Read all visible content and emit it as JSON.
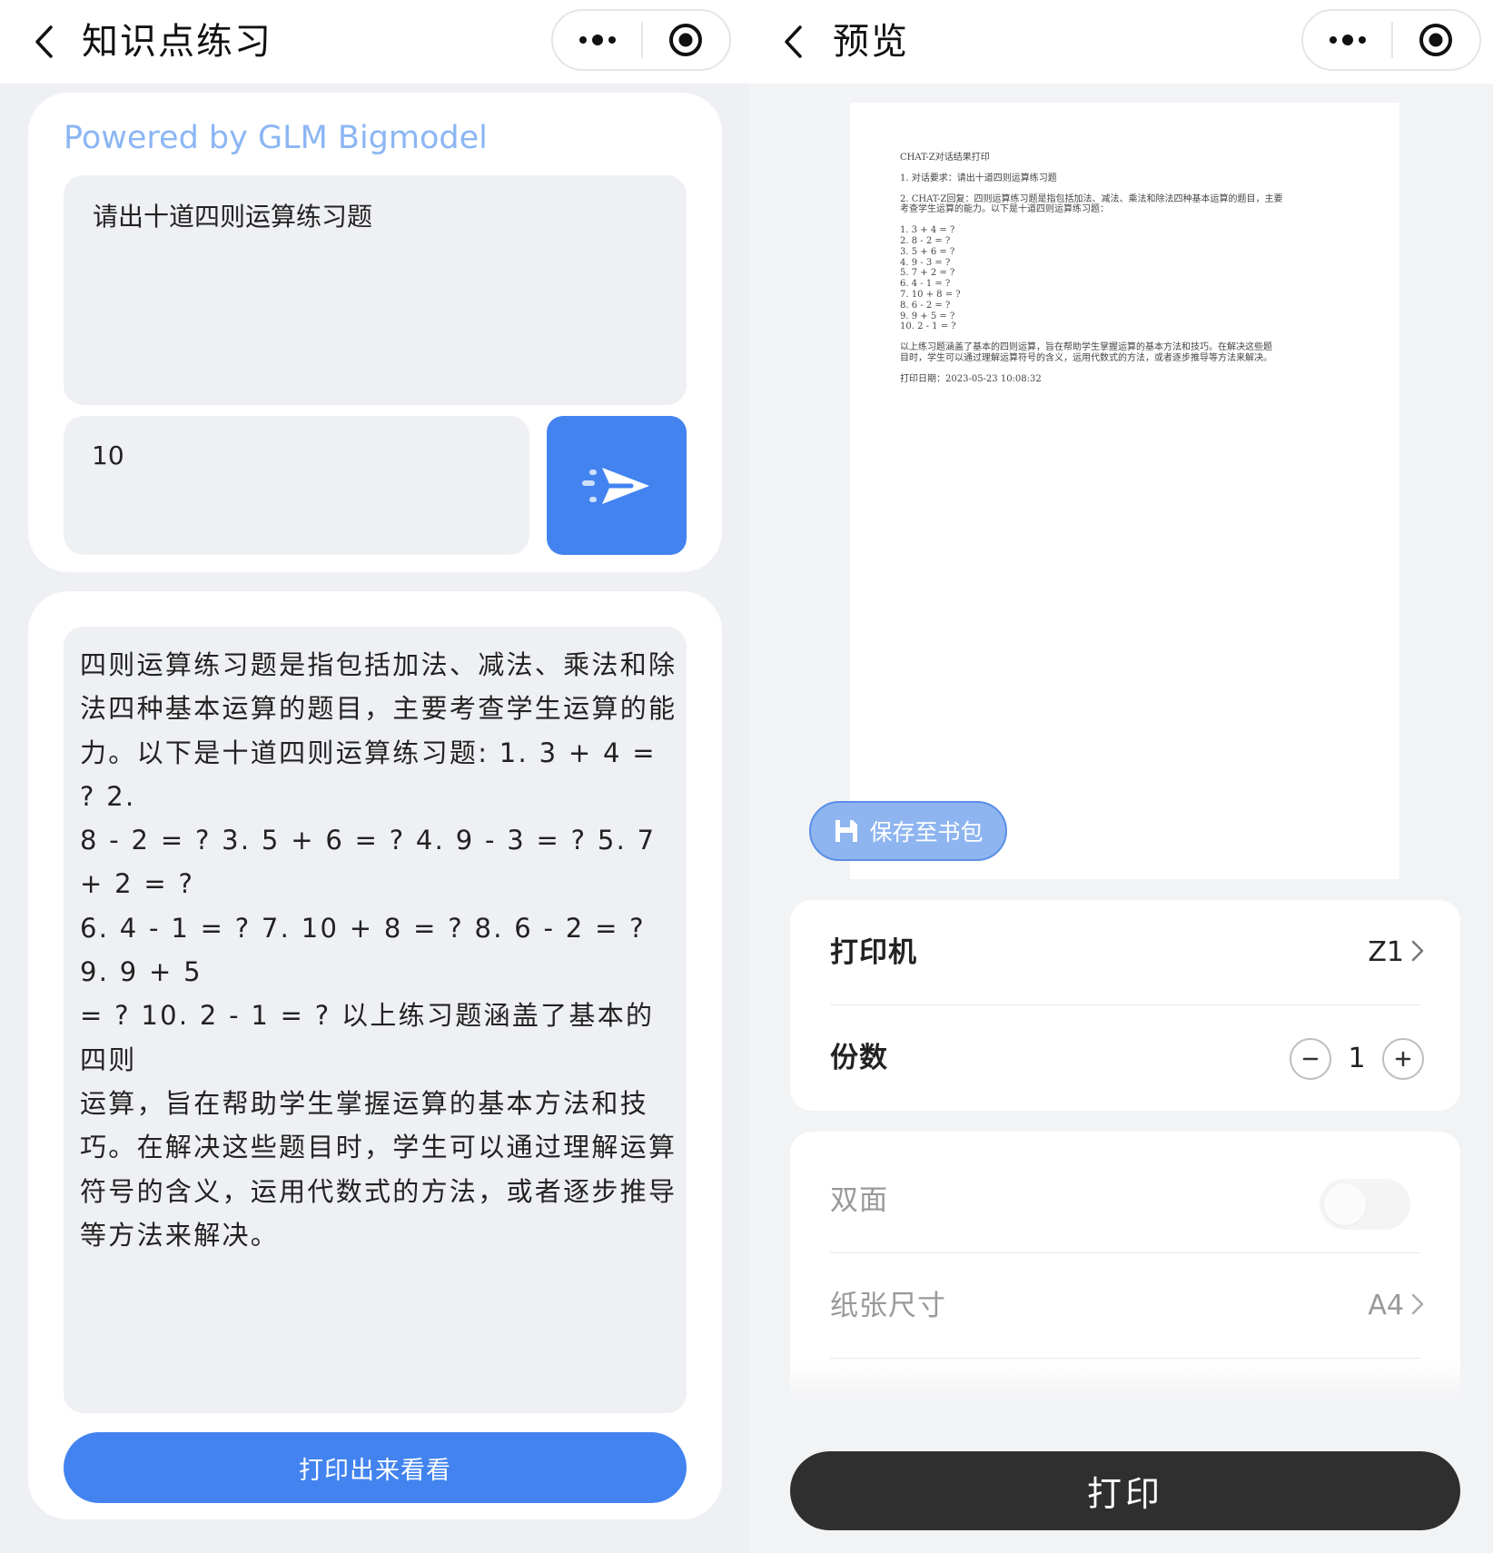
{
  "left": {
    "nav": {
      "title": "知识点练习",
      "back_icon": "chevron-left-icon",
      "more_icon": "more-dots-icon",
      "close_icon": "target-circle-icon"
    },
    "powered_by": "Powered by GLM Bigmodel",
    "prompt_value": "请出十道四则运算练习题",
    "count_value": "10",
    "send_icon": "paper-plane-icon",
    "answer_lines": [
      "四则运算练习题是指包括加法、减法、乘法和除",
      "法四种基本运算的题目，主要考查学生运算的能",
      "力。以下是十道四则运算练习题: 1. 3 + 4 = ? 2.",
      "8 - 2 = ? 3. 5 + 6 = ? 4. 9 - 3 = ? 5. 7 + 2 = ?",
      "6. 4 - 1 = ? 7. 10 + 8 = ? 8. 6 - 2 = ? 9. 9 + 5",
      "= ? 10. 2 - 1 = ? 以上练习题涵盖了基本的四则",
      "运算，旨在帮助学生掌握运算的基本方法和技",
      "巧。在解决这些题目时，学生可以通过理解运算",
      "符号的含义，运用代数式的方法，或者逐步推导",
      "等方法来解决。"
    ],
    "print_button": "打印出来看看"
  },
  "right": {
    "nav": {
      "title": "预览",
      "back_icon": "chevron-left-icon",
      "more_icon": "more-dots-icon",
      "close_icon": "target-circle-icon"
    },
    "doc": {
      "heading": "CHAT-Z对话结果打印",
      "request": "1. 对话要求：请出十道四则运算练习题",
      "reply_l1": "2. CHAT-Z回复：四则运算练习题是指包括加法、减法、乘法和除法四种基本运算的题目，主要",
      "reply_l2": "考查学生运算的能力。以下是十道四则运算练习题：",
      "items": [
        "1. 3 + 4 = ?",
        "2. 8 - 2 = ?",
        "3. 5 + 6 = ?",
        "4. 9 - 3 = ?",
        "5. 7 + 2 = ?",
        "6. 4 - 1 = ?",
        "7. 10 + 8 = ?",
        "8. 6 - 2 = ?",
        "9. 9 + 5 = ?",
        "10. 2 - 1 = ?"
      ],
      "summary_l1": "以上练习题涵盖了基本的四则运算，旨在帮助学生掌握运算的基本方法和技巧。在解决这些题",
      "summary_l2": "目时，学生可以通过理解运算符号的含义，运用代数式的方法，或者逐步推导等方法来解决。",
      "date": "打印日期：2023-05-23 10:08:32"
    },
    "save_button": "保存至书包",
    "save_icon": "floppy-disk-icon",
    "printer": {
      "label": "打印机",
      "value": "Z1"
    },
    "copies": {
      "label": "份数",
      "value": "1",
      "minus_icon": "minus-circle-icon",
      "plus_icon": "plus-circle-icon"
    },
    "duplex": {
      "label": "双面",
      "enabled": false
    },
    "paper_size": {
      "label": "纸张尺寸",
      "value": "A4"
    },
    "print_button": "打印"
  }
}
